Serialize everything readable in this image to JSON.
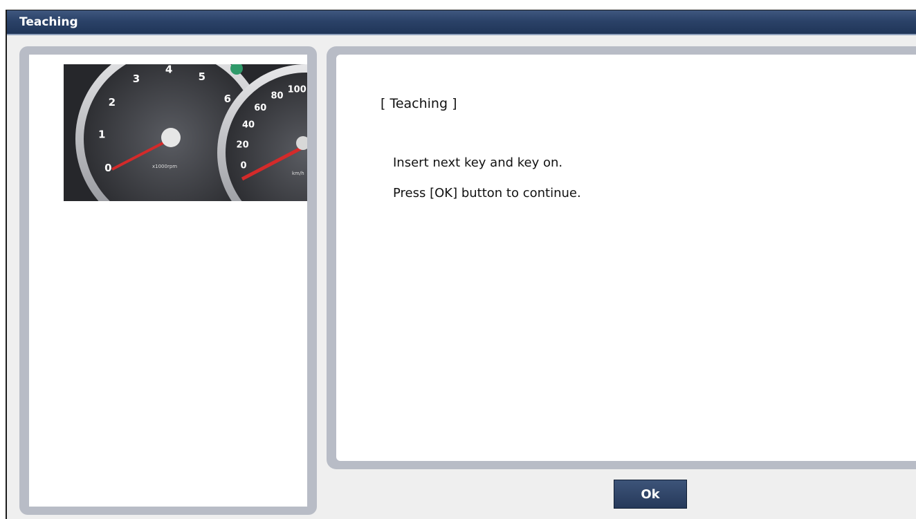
{
  "window": {
    "title": "Teaching"
  },
  "gauge_image": {
    "icon": "instrument-cluster-image",
    "tach_labels": [
      "0",
      "1",
      "2",
      "3",
      "4",
      "5",
      "6"
    ],
    "tach_unit": "x1000rpm",
    "speed_labels": [
      "0",
      "20",
      "40",
      "60",
      "80",
      "100"
    ],
    "speed_unit": "km/h"
  },
  "content": {
    "heading": "[ Teaching ]",
    "line1": "Insert next key and key on.",
    "line2": "Press [OK] button to continue."
  },
  "buttons": {
    "ok_label": "Ok"
  },
  "colors": {
    "titlebar": "#2b4268",
    "panel_frame": "#b8bcc6",
    "button": "#26395a",
    "needle": "#d42a2a"
  }
}
